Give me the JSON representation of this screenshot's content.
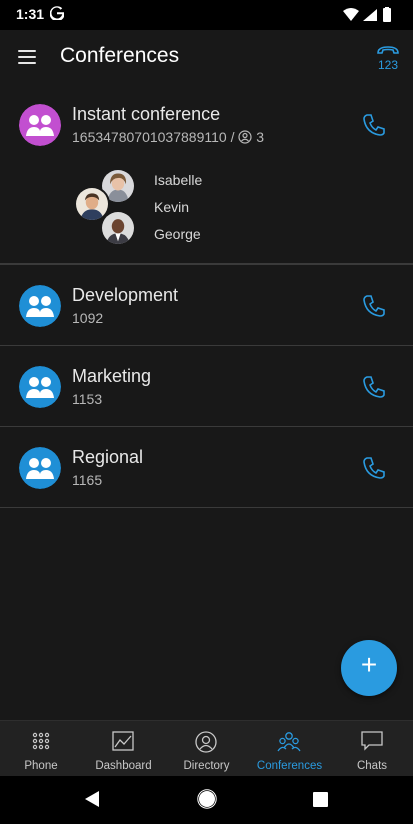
{
  "status_bar": {
    "time": "1:31"
  },
  "header": {
    "title": "Conferences",
    "dialpad_label": "123"
  },
  "conferences": [
    {
      "name": "Instant conference",
      "number": "16534780701037889110",
      "participant_count": "3",
      "color": "#c24fd0"
    },
    {
      "name": "Development",
      "number": "1092",
      "color": "#1f8fd6"
    },
    {
      "name": "Marketing",
      "number": "1153",
      "color": "#1f8fd6"
    },
    {
      "name": "Regional",
      "number": "1165",
      "color": "#1f8fd6"
    }
  ],
  "participants": [
    "Isabelle",
    "Kevin",
    "George"
  ],
  "nav": {
    "items": [
      {
        "label": "Phone",
        "icon": "dialpad-icon"
      },
      {
        "label": "Dashboard",
        "icon": "chart-icon"
      },
      {
        "label": "Directory",
        "icon": "person-icon"
      },
      {
        "label": "Conferences",
        "icon": "people-icon"
      },
      {
        "label": "Chats",
        "icon": "chat-bubble-icon"
      }
    ],
    "active": "Conferences"
  },
  "colors": {
    "accent": "#2a9be0",
    "instant": "#c24fd0",
    "background": "#181818"
  }
}
